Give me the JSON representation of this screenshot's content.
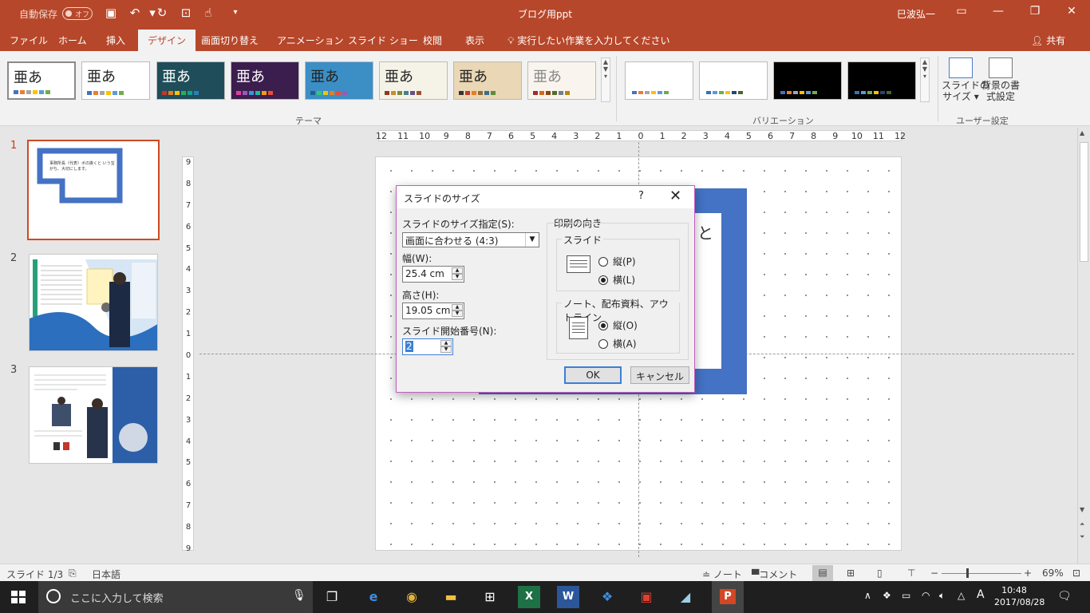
{
  "titlebar": {
    "autosave_label": "自動保存",
    "autosave_state": "オフ",
    "document_title": "ブログ用ppt",
    "user_name": "巳波弘一"
  },
  "tabs": [
    {
      "label": "ファイル"
    },
    {
      "label": "ホーム"
    },
    {
      "label": "挿入"
    },
    {
      "label": "デザイン",
      "active": true
    },
    {
      "label": "画面切り替え"
    },
    {
      "label": "アニメーション"
    },
    {
      "label": "スライド ショー"
    },
    {
      "label": "校閲"
    },
    {
      "label": "表示"
    }
  ],
  "tell_me": "実行したい作業を入力してください",
  "share_label": "共有",
  "ribbon": {
    "theme_glyph": "亜あ",
    "themes_group_label": "テーマ",
    "variants_group_label": "バリエーション",
    "custom_group_label": "ユーザー設定",
    "slide_size_button": "スライドの\nサイズ",
    "background_button": "背景の書\n式設定"
  },
  "slides_panel": {
    "numbers": [
      "1",
      "2",
      "3"
    ],
    "thumb1_text": "事務所長（代表）ボの挨くと いう宝がち、大切にします。"
  },
  "canvas": {
    "hruler_ticks": [
      "12",
      "11",
      "10",
      "9",
      "8",
      "7",
      "6",
      "5",
      "4",
      "3",
      "2",
      "1",
      "0",
      "1",
      "2",
      "3",
      "4",
      "5",
      "6",
      "7",
      "8",
      "9",
      "10",
      "11",
      "12"
    ],
    "vruler_ticks": [
      "9",
      "8",
      "7",
      "6",
      "5",
      "4",
      "3",
      "2",
      "1",
      "0",
      "1",
      "2",
      "3",
      "4",
      "5",
      "6",
      "7",
      "8",
      "9"
    ],
    "slide_text": "と"
  },
  "dialog": {
    "title": "スライドのサイズ",
    "help": "?",
    "close": "✕",
    "size_for_label": "スライドのサイズ指定(S):",
    "size_for_value": "画面に合わせる (4:3)",
    "width_label": "幅(W):",
    "width_value": "25.4 cm",
    "height_label": "高さ(H):",
    "height_value": "19.05 cm",
    "start_number_label": "スライド開始番号(N):",
    "start_number_value": "2",
    "orientation_label": "印刷の向き",
    "slides_group": "スライド",
    "slides_portrait": "縦(P)",
    "slides_landscape": "横(L)",
    "notes_group": "ノート、配布資料、アウトライン",
    "notes_portrait": "縦(O)",
    "notes_landscape": "横(A)",
    "ok": "OK",
    "cancel": "キャンセル"
  },
  "statusbar": {
    "slide_info": "スライド 1/3",
    "language": "日本語",
    "notes": "ノート",
    "comments": "コメント",
    "zoom_minus": "−",
    "zoom_plus": "+",
    "zoom_level": "69%"
  },
  "taskbar": {
    "search_placeholder": "ここに入力して検索",
    "time": "10:48",
    "date": "2017/08/28",
    "ime": "A"
  },
  "colors": {
    "accent": "#b7472a",
    "shape_blue": "#4472c4"
  }
}
